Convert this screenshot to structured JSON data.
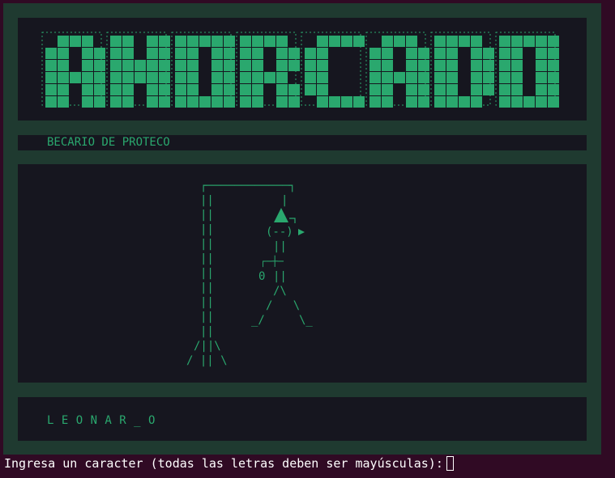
{
  "title_logo": "AHORCADO",
  "subtitle": "BECARIO DE PROTECO",
  "word_progress": "L E O N A R _ O",
  "prompt": "Ingresa un caracter (todas las letras deben ser mayúsculas):",
  "hangman": {
    "gallows_top": "┌────────────┐",
    "gallows_rows": [
      "||",
      "||",
      "||",
      "||",
      "||",
      "||",
      "||",
      "||",
      "||",
      "||"
    ],
    "gallows_base_1": "/||\\",
    "gallows_base_2": "/ || \\",
    "figure_eyes": "(--)",
    "figure_neck": "||",
    "figure_arm": "┌─┼─",
    "figure_arm_zero": "0",
    "figure_body": "||",
    "figure_hip": "/\\",
    "figure_legs": "/   \\",
    "figure_feet": "_/     \\_"
  },
  "colors": {
    "accent": "#2aa86e",
    "terminal_bg": "#300a24",
    "frame": "#1f3a30",
    "panel": "#16161f"
  }
}
